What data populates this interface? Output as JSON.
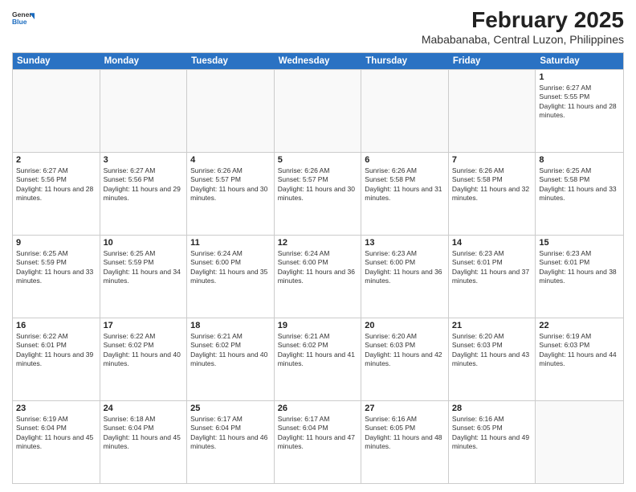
{
  "logo": {
    "general": "General",
    "blue": "Blue"
  },
  "title": "February 2025",
  "location": "Mababanaba, Central Luzon, Philippines",
  "days_header": [
    "Sunday",
    "Monday",
    "Tuesday",
    "Wednesday",
    "Thursday",
    "Friday",
    "Saturday"
  ],
  "weeks": [
    [
      {
        "day": "",
        "info": ""
      },
      {
        "day": "",
        "info": ""
      },
      {
        "day": "",
        "info": ""
      },
      {
        "day": "",
        "info": ""
      },
      {
        "day": "",
        "info": ""
      },
      {
        "day": "",
        "info": ""
      },
      {
        "day": "1",
        "info": "Sunrise: 6:27 AM\nSunset: 5:55 PM\nDaylight: 11 hours and 28 minutes."
      }
    ],
    [
      {
        "day": "2",
        "info": "Sunrise: 6:27 AM\nSunset: 5:56 PM\nDaylight: 11 hours and 28 minutes."
      },
      {
        "day": "3",
        "info": "Sunrise: 6:27 AM\nSunset: 5:56 PM\nDaylight: 11 hours and 29 minutes."
      },
      {
        "day": "4",
        "info": "Sunrise: 6:26 AM\nSunset: 5:57 PM\nDaylight: 11 hours and 30 minutes."
      },
      {
        "day": "5",
        "info": "Sunrise: 6:26 AM\nSunset: 5:57 PM\nDaylight: 11 hours and 30 minutes."
      },
      {
        "day": "6",
        "info": "Sunrise: 6:26 AM\nSunset: 5:58 PM\nDaylight: 11 hours and 31 minutes."
      },
      {
        "day": "7",
        "info": "Sunrise: 6:26 AM\nSunset: 5:58 PM\nDaylight: 11 hours and 32 minutes."
      },
      {
        "day": "8",
        "info": "Sunrise: 6:25 AM\nSunset: 5:58 PM\nDaylight: 11 hours and 33 minutes."
      }
    ],
    [
      {
        "day": "9",
        "info": "Sunrise: 6:25 AM\nSunset: 5:59 PM\nDaylight: 11 hours and 33 minutes."
      },
      {
        "day": "10",
        "info": "Sunrise: 6:25 AM\nSunset: 5:59 PM\nDaylight: 11 hours and 34 minutes."
      },
      {
        "day": "11",
        "info": "Sunrise: 6:24 AM\nSunset: 6:00 PM\nDaylight: 11 hours and 35 minutes."
      },
      {
        "day": "12",
        "info": "Sunrise: 6:24 AM\nSunset: 6:00 PM\nDaylight: 11 hours and 36 minutes."
      },
      {
        "day": "13",
        "info": "Sunrise: 6:23 AM\nSunset: 6:00 PM\nDaylight: 11 hours and 36 minutes."
      },
      {
        "day": "14",
        "info": "Sunrise: 6:23 AM\nSunset: 6:01 PM\nDaylight: 11 hours and 37 minutes."
      },
      {
        "day": "15",
        "info": "Sunrise: 6:23 AM\nSunset: 6:01 PM\nDaylight: 11 hours and 38 minutes."
      }
    ],
    [
      {
        "day": "16",
        "info": "Sunrise: 6:22 AM\nSunset: 6:01 PM\nDaylight: 11 hours and 39 minutes."
      },
      {
        "day": "17",
        "info": "Sunrise: 6:22 AM\nSunset: 6:02 PM\nDaylight: 11 hours and 40 minutes."
      },
      {
        "day": "18",
        "info": "Sunrise: 6:21 AM\nSunset: 6:02 PM\nDaylight: 11 hours and 40 minutes."
      },
      {
        "day": "19",
        "info": "Sunrise: 6:21 AM\nSunset: 6:02 PM\nDaylight: 11 hours and 41 minutes."
      },
      {
        "day": "20",
        "info": "Sunrise: 6:20 AM\nSunset: 6:03 PM\nDaylight: 11 hours and 42 minutes."
      },
      {
        "day": "21",
        "info": "Sunrise: 6:20 AM\nSunset: 6:03 PM\nDaylight: 11 hours and 43 minutes."
      },
      {
        "day": "22",
        "info": "Sunrise: 6:19 AM\nSunset: 6:03 PM\nDaylight: 11 hours and 44 minutes."
      }
    ],
    [
      {
        "day": "23",
        "info": "Sunrise: 6:19 AM\nSunset: 6:04 PM\nDaylight: 11 hours and 45 minutes."
      },
      {
        "day": "24",
        "info": "Sunrise: 6:18 AM\nSunset: 6:04 PM\nDaylight: 11 hours and 45 minutes."
      },
      {
        "day": "25",
        "info": "Sunrise: 6:17 AM\nSunset: 6:04 PM\nDaylight: 11 hours and 46 minutes."
      },
      {
        "day": "26",
        "info": "Sunrise: 6:17 AM\nSunset: 6:04 PM\nDaylight: 11 hours and 47 minutes."
      },
      {
        "day": "27",
        "info": "Sunrise: 6:16 AM\nSunset: 6:05 PM\nDaylight: 11 hours and 48 minutes."
      },
      {
        "day": "28",
        "info": "Sunrise: 6:16 AM\nSunset: 6:05 PM\nDaylight: 11 hours and 49 minutes."
      },
      {
        "day": "",
        "info": ""
      }
    ]
  ]
}
